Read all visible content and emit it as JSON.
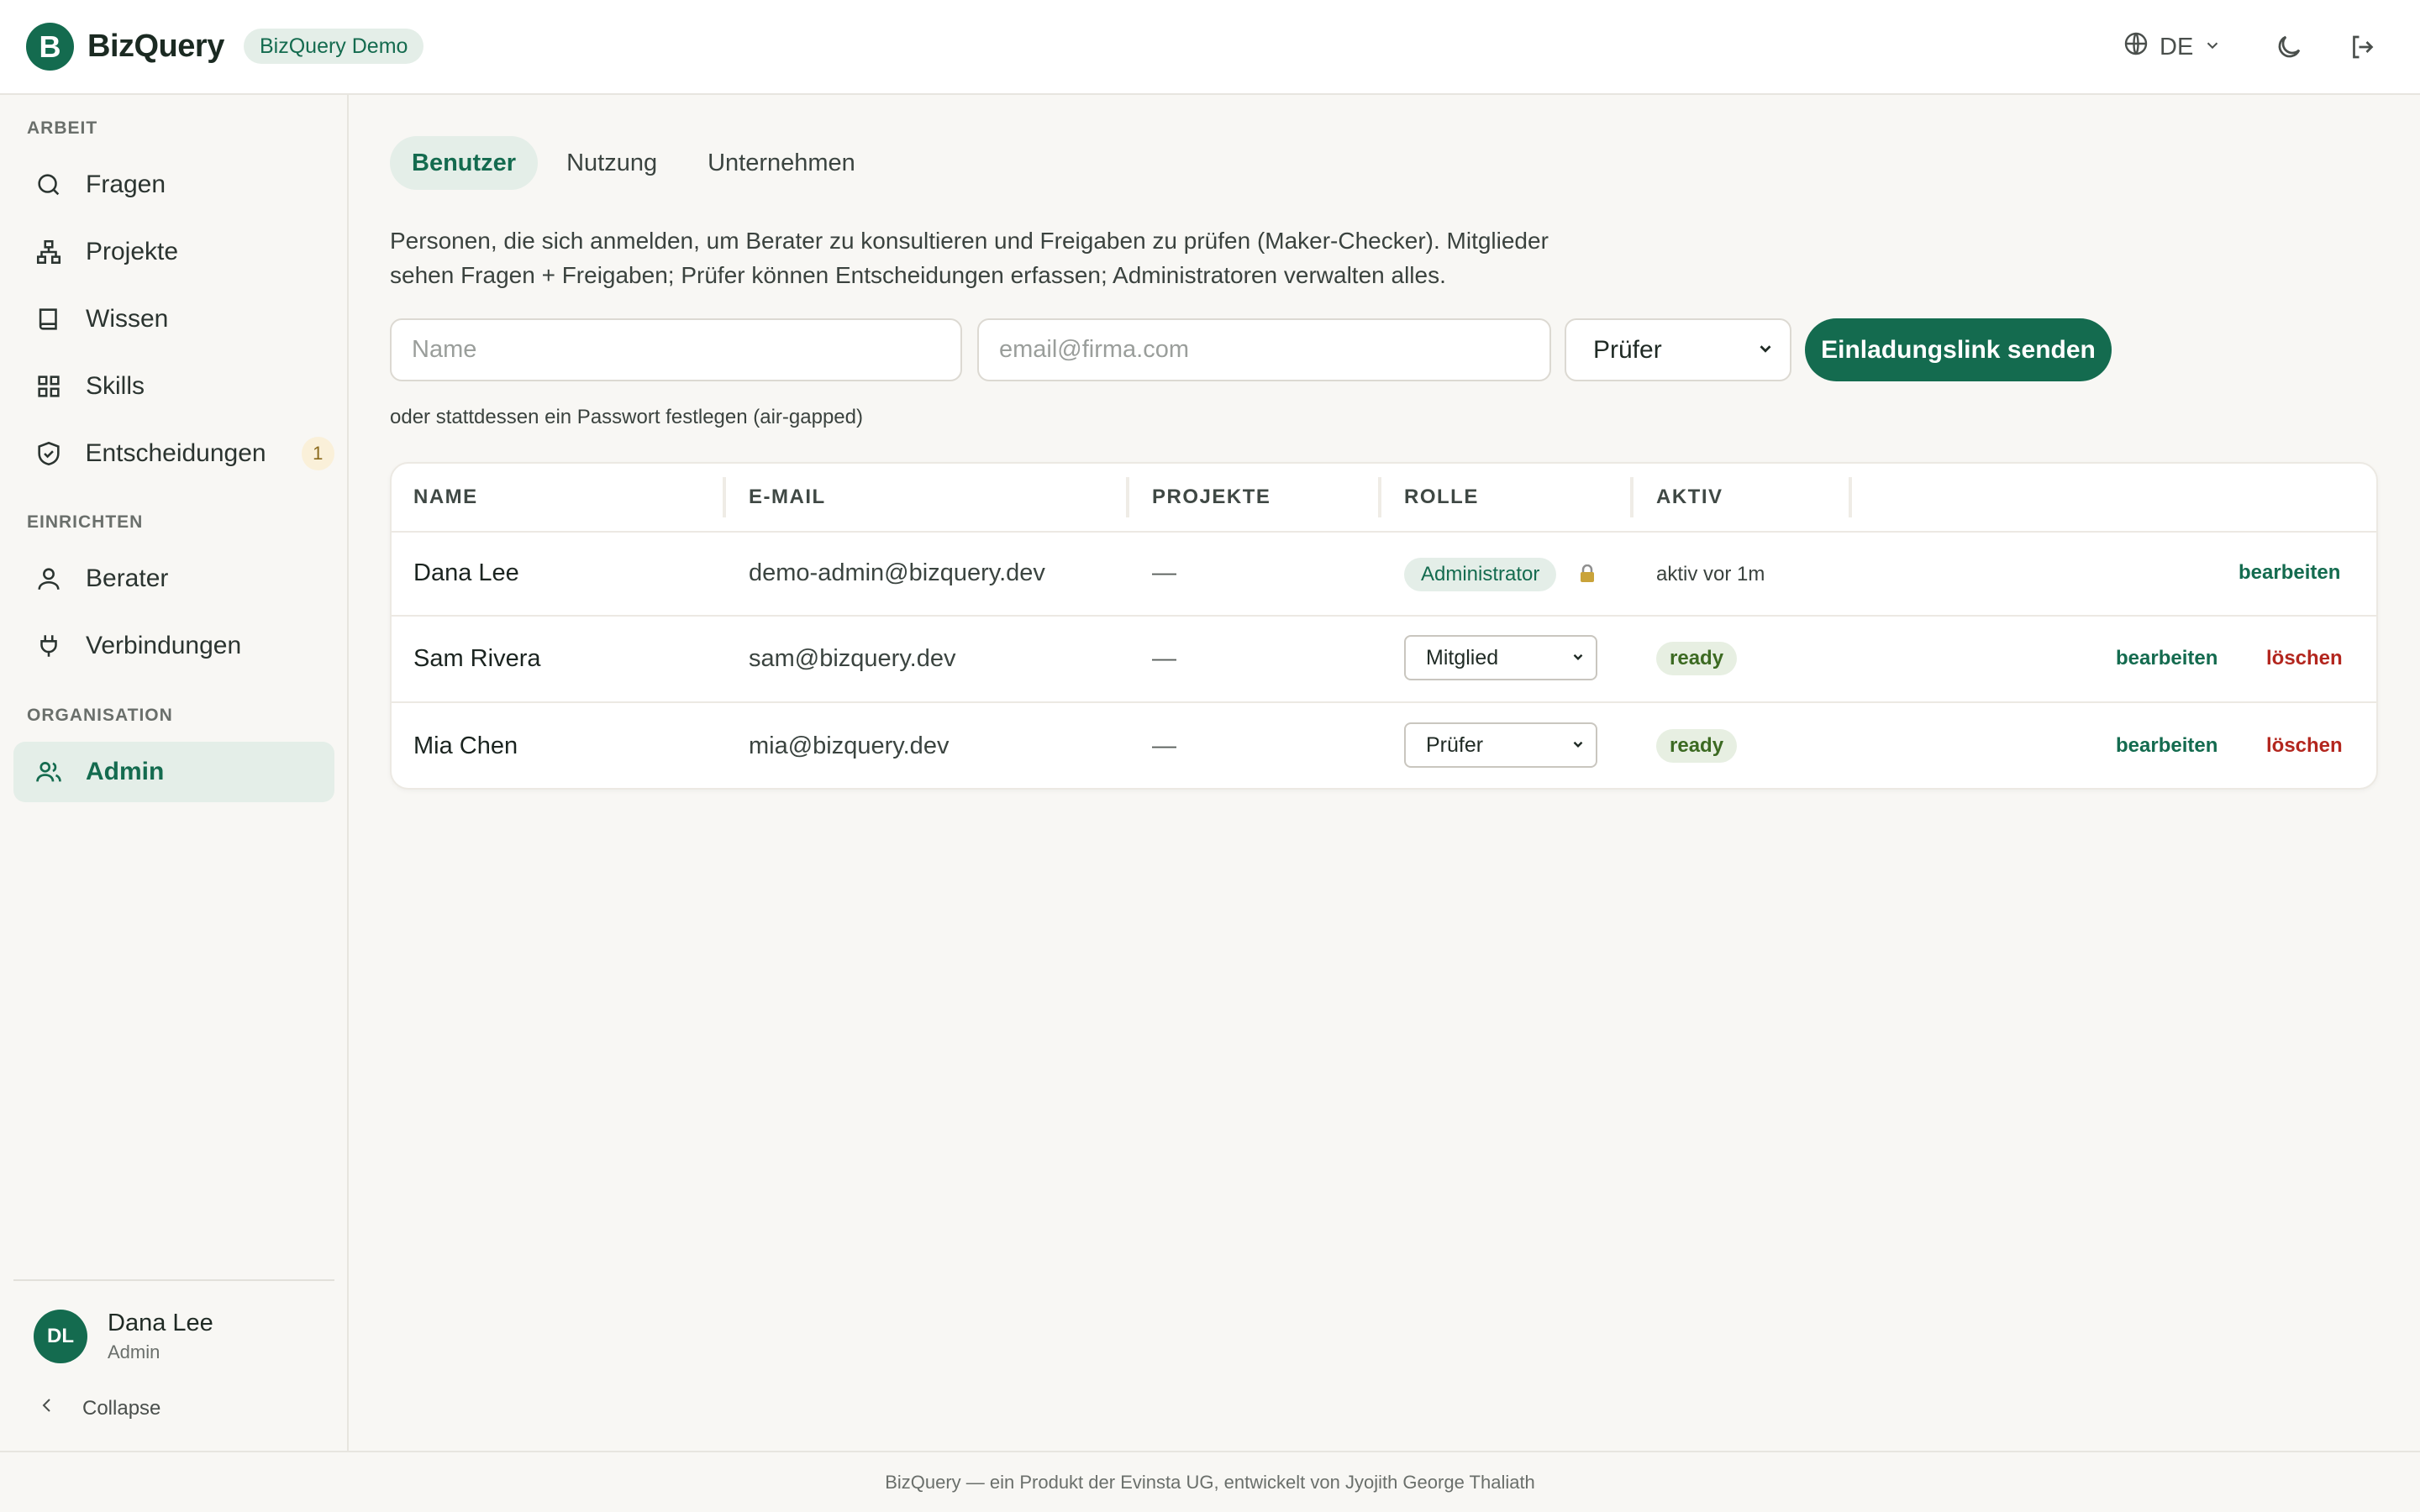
{
  "app": {
    "logo_letter": "B",
    "brand_name": "BizQuery",
    "demo_badge": "BizQuery Demo",
    "brand_color": "#146b4f"
  },
  "topbar": {
    "language": "DE",
    "icons": [
      "globe-icon",
      "chevron-down-icon",
      "moon-icon",
      "logout-icon"
    ]
  },
  "sidebar": {
    "sections": [
      {
        "title": "ARBEIT",
        "items": [
          {
            "label": "Fragen",
            "icon": "search-icon"
          },
          {
            "label": "Projekte",
            "icon": "hierarchy-icon"
          },
          {
            "label": "Wissen",
            "icon": "book-icon"
          },
          {
            "label": "Skills",
            "icon": "grid-icon"
          },
          {
            "label": "Entscheidungen",
            "icon": "shield-check-icon",
            "badge": "1"
          }
        ]
      },
      {
        "title": "EINRICHTEN",
        "items": [
          {
            "label": "Berater",
            "icon": "user-icon"
          },
          {
            "label": "Verbindungen",
            "icon": "plug-icon"
          }
        ]
      },
      {
        "title": "ORGANISATION",
        "items": [
          {
            "label": "Admin",
            "icon": "users-icon",
            "active": true
          }
        ]
      }
    ],
    "user": {
      "initials": "DL",
      "name": "Dana Lee",
      "role": "Admin"
    },
    "collapse_label": "Collapse"
  },
  "main": {
    "tabs": [
      {
        "label": "Benutzer",
        "active": true
      },
      {
        "label": "Nutzung"
      },
      {
        "label": "Unternehmen"
      }
    ],
    "description_line1": "Personen, die sich anmelden, um Berater zu konsultieren und Freigaben zu prüfen (Maker-Checker). Mitglieder",
    "description_line2": "sehen Fragen + Freigaben; Prüfer können Entscheidungen erfassen; Administratoren verwalten alles.",
    "invite": {
      "name_placeholder": "Name",
      "email_placeholder": "email@firma.com",
      "role_value": "Prüfer",
      "button_label": "Einladungslink senden"
    },
    "password_link": "oder stattdessen ein Passwort festlegen (air-gapped)",
    "table": {
      "headers": [
        "NAME",
        "E-MAIL",
        "PROJEKTE",
        "ROLLE",
        "AKTIV"
      ],
      "rows": [
        {
          "name": "Dana Lee",
          "email": "demo-admin@bizquery.dev",
          "projects": "—",
          "role": "Administrator",
          "role_type": "badge",
          "active": "aktiv vor 1m",
          "edit": "bearbeiten"
        },
        {
          "name": "Sam Rivera",
          "email": "sam@bizquery.dev",
          "projects": "—",
          "role": "Mitglied",
          "role_type": "select",
          "active": "ready",
          "edit": "bearbeiten",
          "delete": "löschen"
        },
        {
          "name": "Mia Chen",
          "email": "mia@bizquery.dev",
          "projects": "—",
          "role": "Prüfer",
          "role_type": "select",
          "active": "ready",
          "edit": "bearbeiten",
          "delete": "löschen"
        }
      ]
    }
  },
  "footer": {
    "text": "BizQuery — ein Produkt der Evinsta UG, entwickelt von Jyojith George Thaliath"
  }
}
